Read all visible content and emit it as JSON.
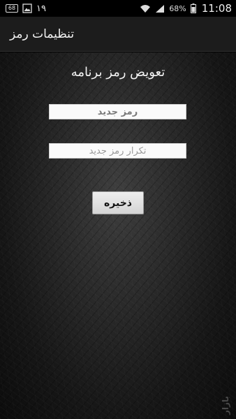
{
  "status_bar": {
    "left_badge": "68",
    "notification_count": "۱۹",
    "battery_percent": "68%",
    "time": "11:08",
    "icons": [
      "battery-small-icon",
      "image-notification-icon",
      "wifi-icon",
      "signal-icon",
      "battery-icon"
    ]
  },
  "action_bar": {
    "title": "تنظیمات رمز"
  },
  "main": {
    "heading": "تعویض رمز برنامه",
    "new_password": {
      "placeholder": "رمز جدید",
      "value": ""
    },
    "repeat_password": {
      "placeholder": "تکرار رمز جدید",
      "value": ""
    },
    "save_label": "ذخیره"
  },
  "watermark": "بازار",
  "colors": {
    "action_bar_bg": "#1c1c1c",
    "background": "#2a2a2a",
    "text": "#f4f4f4"
  }
}
